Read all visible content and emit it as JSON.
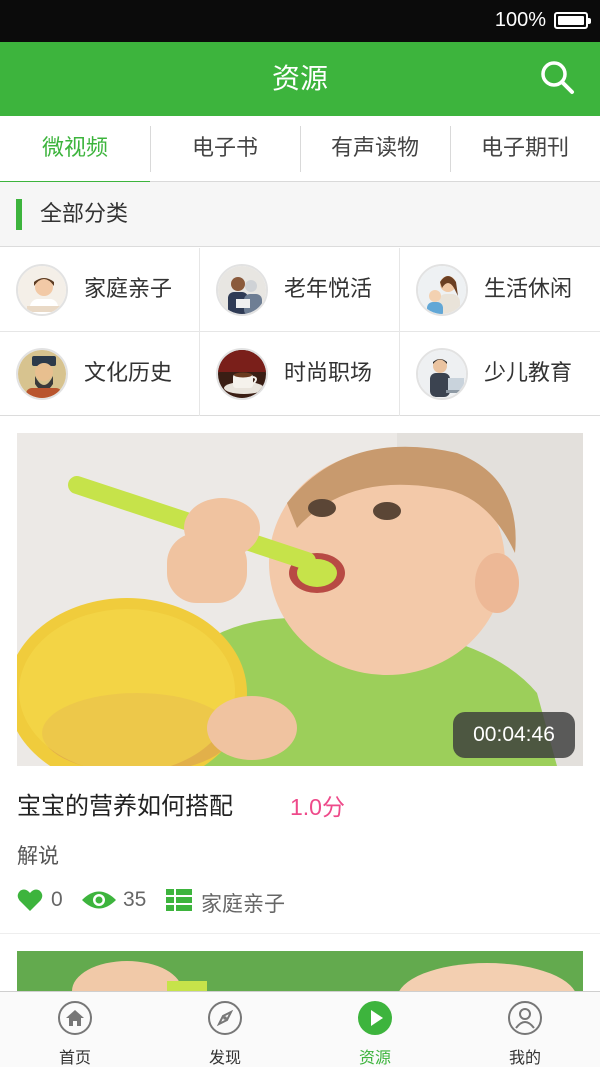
{
  "status_bar": {
    "battery_percent": "100%"
  },
  "header": {
    "title": "资源",
    "search_icon": "search-icon"
  },
  "tabs": [
    {
      "label": "微视频",
      "active": true
    },
    {
      "label": "电子书",
      "active": false
    },
    {
      "label": "有声读物",
      "active": false
    },
    {
      "label": "电子期刊",
      "active": false
    }
  ],
  "categories": {
    "title": "全部分类",
    "items": [
      {
        "label": "家庭亲子",
        "icon": "family-avatar"
      },
      {
        "label": "老年悦活",
        "icon": "elderly-avatar"
      },
      {
        "label": "生活休闲",
        "icon": "leisure-avatar"
      },
      {
        "label": "文化历史",
        "icon": "history-avatar"
      },
      {
        "label": "时尚职场",
        "icon": "coffee-avatar"
      },
      {
        "label": "少儿教育",
        "icon": "education-avatar"
      }
    ]
  },
  "videos": [
    {
      "title": "宝宝的营养如何搭配",
      "score": "1.0分",
      "subtitle": "解说",
      "duration": "00:04:46",
      "likes": "0",
      "views": "35",
      "category": "家庭亲子"
    }
  ],
  "bottom_nav": [
    {
      "label": "首页",
      "icon": "home-icon",
      "active": false
    },
    {
      "label": "发现",
      "icon": "compass-icon",
      "active": false
    },
    {
      "label": "资源",
      "icon": "play-icon",
      "active": true
    },
    {
      "label": "我的",
      "icon": "user-icon",
      "active": false
    }
  ],
  "colors": {
    "brand_green": "#3db43d",
    "score_pink": "#ee4a8a",
    "status_bar": "#0b0b0b"
  }
}
